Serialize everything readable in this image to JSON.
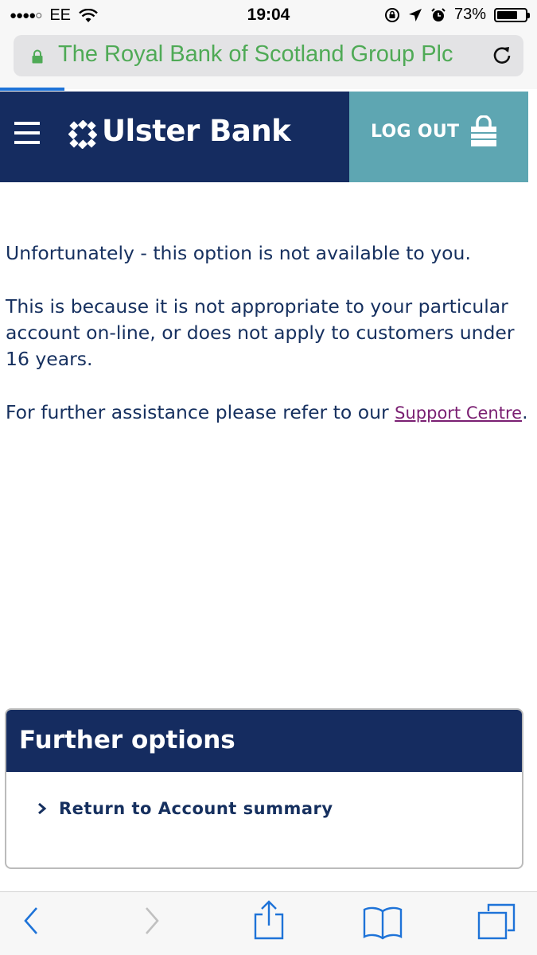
{
  "status_bar": {
    "signal": "●●●●○",
    "carrier": "EE",
    "time": "19:04",
    "battery_percent": "73%",
    "battery_level": 0.73
  },
  "browser": {
    "address": "The Royal Bank of Scotland Group Plc",
    "address_color": "#4faa56",
    "load_progress": 0.12
  },
  "header": {
    "logo_text": "Ulster Bank",
    "logout_label": "LOG OUT",
    "brand_color": "#152c60",
    "logout_color": "#5ea6b2"
  },
  "content": {
    "paragraph1": "Unfortunately - this option is not available to you.",
    "paragraph2": "This is because it is not appropriate to your particular account on-line, or does not apply to customers under 16 years.",
    "paragraph3_prefix": "For further assistance please refer to our ",
    "support_link": "Support Centre",
    "paragraph3_suffix": "."
  },
  "further_options": {
    "title": "Further options",
    "link": "Return to Account summary"
  },
  "toolbar": {
    "icons": [
      "back-icon",
      "forward-icon",
      "share-icon",
      "bookmarks-icon",
      "tabs-icon"
    ]
  }
}
